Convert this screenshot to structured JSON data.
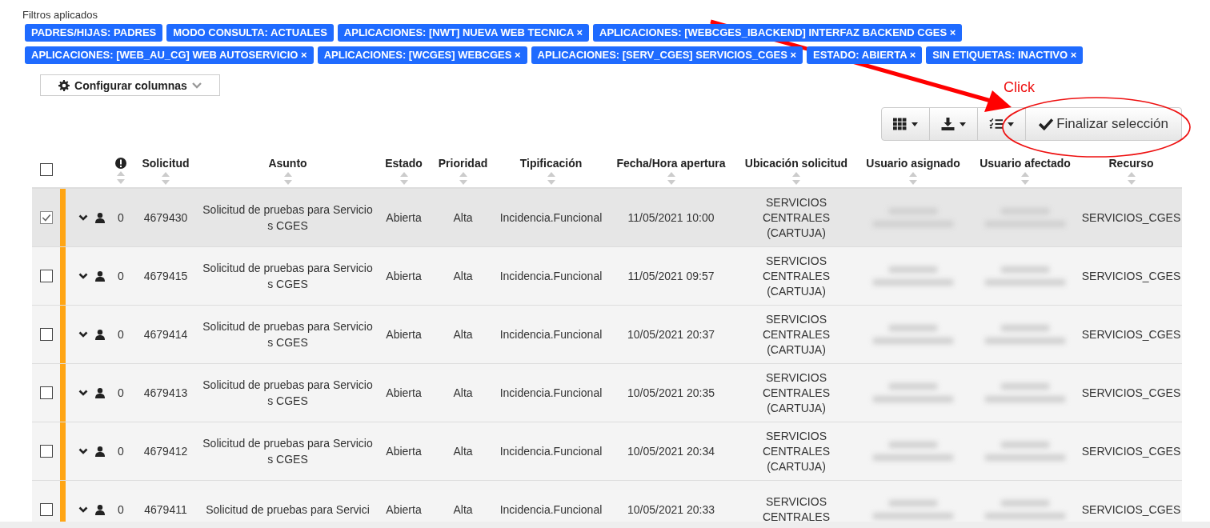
{
  "filters": {
    "label": "Filtros aplicados",
    "tags": [
      {
        "text": "PADRES/HIJAS: PADRES"
      },
      {
        "text": "MODO CONSULTA: ACTUALES"
      },
      {
        "text": "APLICACIONES: [NWT] NUEVA WEB TECNICA",
        "remove": "×"
      },
      {
        "text": "APLICACIONES: [WEBCGES_IBACKEND] INTERFAZ BACKEND CGES",
        "remove": "×"
      },
      {
        "text": "APLICACIONES: [WEB_AU_CG] WEB AUTOSERVICIO",
        "remove": "×"
      },
      {
        "text": "APLICACIONES: [WCGES] WEBCGES",
        "remove": "×"
      },
      {
        "text": "APLICACIONES: [SERV_CGES] SERVICIOS_CGES",
        "remove": "×"
      },
      {
        "text": "ESTADO: ABIERTA",
        "remove": "×"
      },
      {
        "text": "SIN ETIQUETAS: INACTIVO",
        "remove": "×"
      }
    ]
  },
  "configure_columns": {
    "label": "Configurar columnas"
  },
  "toolbar": {
    "finish_button": "Finalizar selección"
  },
  "annotation": {
    "label": "Click"
  },
  "table": {
    "select_all": {
      "checked": false
    },
    "columns": [
      "Solicitud",
      "Asunto",
      "Estado",
      "Prioridad",
      "Tipificación",
      "Fecha/Hora apertura",
      "Ubicación solicitud",
      "Usuario asignado",
      "Usuario afectado",
      "Recurso"
    ],
    "rows": [
      {
        "checked": true,
        "count": "0",
        "id": "4679430",
        "subject": "Solicitud de pruebas para Servicios CGES",
        "status": "Abierta",
        "priority": "Alta",
        "type": "Incidencia.Funcional",
        "opened": "11/05/2021 10:00",
        "location": "SERVICIOS CENTRALES (CARTUJA)",
        "resource": "SERVICIOS_CGES"
      },
      {
        "checked": false,
        "count": "0",
        "id": "4679415",
        "subject": "Solicitud de pruebas para Servicios CGES",
        "status": "Abierta",
        "priority": "Alta",
        "type": "Incidencia.Funcional",
        "opened": "11/05/2021 09:57",
        "location": "SERVICIOS CENTRALES (CARTUJA)",
        "resource": "SERVICIOS_CGES"
      },
      {
        "checked": false,
        "count": "0",
        "id": "4679414",
        "subject": "Solicitud de pruebas para Servicios CGES",
        "status": "Abierta",
        "priority": "Alta",
        "type": "Incidencia.Funcional",
        "opened": "10/05/2021 20:37",
        "location": "SERVICIOS CENTRALES (CARTUJA)",
        "resource": "SERVICIOS_CGES"
      },
      {
        "checked": false,
        "count": "0",
        "id": "4679413",
        "subject": "Solicitud de pruebas para Servicios CGES",
        "status": "Abierta",
        "priority": "Alta",
        "type": "Incidencia.Funcional",
        "opened": "10/05/2021 20:35",
        "location": "SERVICIOS CENTRALES (CARTUJA)",
        "resource": "SERVICIOS_CGES"
      },
      {
        "checked": false,
        "count": "0",
        "id": "4679412",
        "subject": "Solicitud de pruebas para Servicios CGES",
        "status": "Abierta",
        "priority": "Alta",
        "type": "Incidencia.Funcional",
        "opened": "10/05/2021 20:34",
        "location": "SERVICIOS CENTRALES (CARTUJA)",
        "resource": "SERVICIOS_CGES"
      },
      {
        "checked": false,
        "count": "0",
        "id": "4679411",
        "subject": "Solicitud de pruebas para Servici",
        "status": "Abierta",
        "priority": "Alta",
        "type": "Incidencia.Funcional",
        "opened": "10/05/2021 20:33",
        "location": "SERVICIOS CENTRALES",
        "resource": "SERVICIOS_CGES"
      }
    ]
  }
}
